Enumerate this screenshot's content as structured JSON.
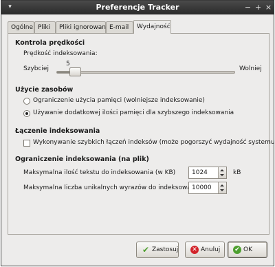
{
  "window": {
    "title": "Preferencje Tracker",
    "controls": {
      "menu": "▾",
      "minimize": "−",
      "maximize": "+",
      "close": "×"
    }
  },
  "tabs": [
    {
      "label": "Ogólne"
    },
    {
      "label": "Pliki"
    },
    {
      "label": "Pliki ignorowane"
    },
    {
      "label": "E-mail"
    },
    {
      "label": "Wydajność",
      "active": true
    }
  ],
  "speed": {
    "section_title": "Kontrola prędkości",
    "label": "Prędkość indeksowania:",
    "value": "5",
    "min_label": "Szybciej",
    "max_label": "Wolniej",
    "value_fraction": 0.08
  },
  "resources": {
    "section_title": "Użycie zasobów",
    "options": [
      {
        "label": "Ograniczenie użycia pamięci (wolniejsze indeksowanie)",
        "selected": false
      },
      {
        "label": "Używanie dodatkowej ilości pamięci dla szybszego indeksowania",
        "selected": true
      }
    ]
  },
  "merge": {
    "section_title": "Łączenie indeksowania",
    "checkbox_label": "Wykonywanie szybkich łączeń indeksów (może pogorszyć wydajność systemu)",
    "checked": false
  },
  "limits": {
    "section_title": "Ograniczenie indeksowania (na plik)",
    "max_text_label": "Maksymalna ilość tekstu do indeksowania (w KB)",
    "max_text_value": "1024",
    "max_text_unit": "kB",
    "max_words_label": "Maksymalna liczba unikalnych wyrazów do indeksowania",
    "max_words_value": "10000"
  },
  "buttons": {
    "apply": "Zastosuj",
    "cancel": "Anuluj",
    "ok": "OK"
  },
  "colors": {
    "titlebar": "#2c2c2c",
    "window_bg": "#edeceb",
    "ok_green": "#4d9f2f",
    "cancel_red": "#d2232a"
  }
}
